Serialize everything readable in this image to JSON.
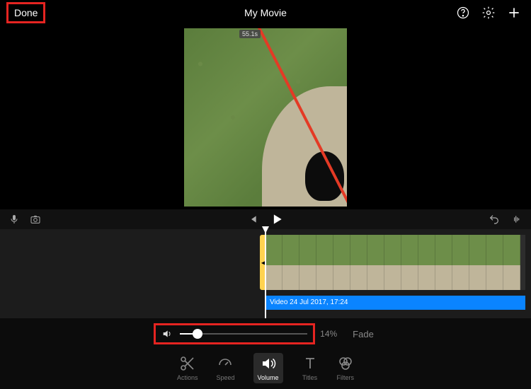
{
  "header": {
    "done_label": "Done",
    "title": "My Movie"
  },
  "preview": {
    "timecode": "55.1s"
  },
  "timeline": {
    "audio_label": "Video 24 Jul 2017, 17:24"
  },
  "volume": {
    "percent_label": "14%",
    "percent_value": 14,
    "fade_label": "Fade"
  },
  "tools": {
    "actions": "Actions",
    "speed": "Speed",
    "volume": "Volume",
    "titles": "Titles",
    "filters": "Filters"
  }
}
